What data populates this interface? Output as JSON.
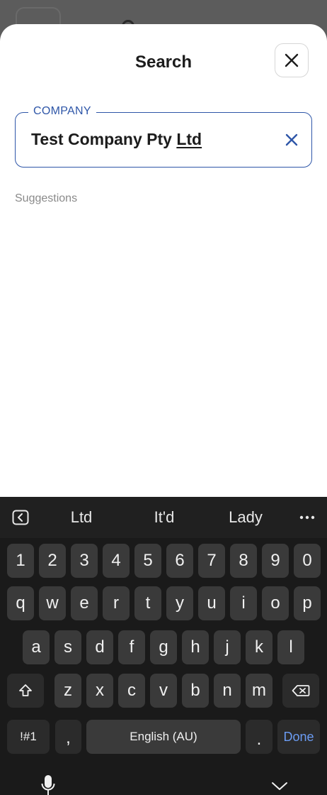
{
  "sheet": {
    "title": "Search"
  },
  "company_field": {
    "label": "COMPANY",
    "value_prefix": "Test Company Pty ",
    "value_composing": "Ltd"
  },
  "suggestions_label": "Suggestions",
  "keyboard": {
    "suggestions": [
      "Ltd",
      "It'd",
      "Lady"
    ],
    "row_numbers": [
      "1",
      "2",
      "3",
      "4",
      "5",
      "6",
      "7",
      "8",
      "9",
      "0"
    ],
    "row_1": [
      "q",
      "w",
      "e",
      "r",
      "t",
      "y",
      "u",
      "i",
      "o",
      "p"
    ],
    "row_2": [
      "a",
      "s",
      "d",
      "f",
      "g",
      "h",
      "j",
      "k",
      "l"
    ],
    "row_3": [
      "z",
      "x",
      "c",
      "v",
      "b",
      "n",
      "m"
    ],
    "symbols_label": "!#1",
    "comma_label": ",",
    "space_label": "English (AU)",
    "period_label": ".",
    "done_label": "Done"
  },
  "colors": {
    "accent": "#2e56a8",
    "done": "#6b9cf3"
  }
}
